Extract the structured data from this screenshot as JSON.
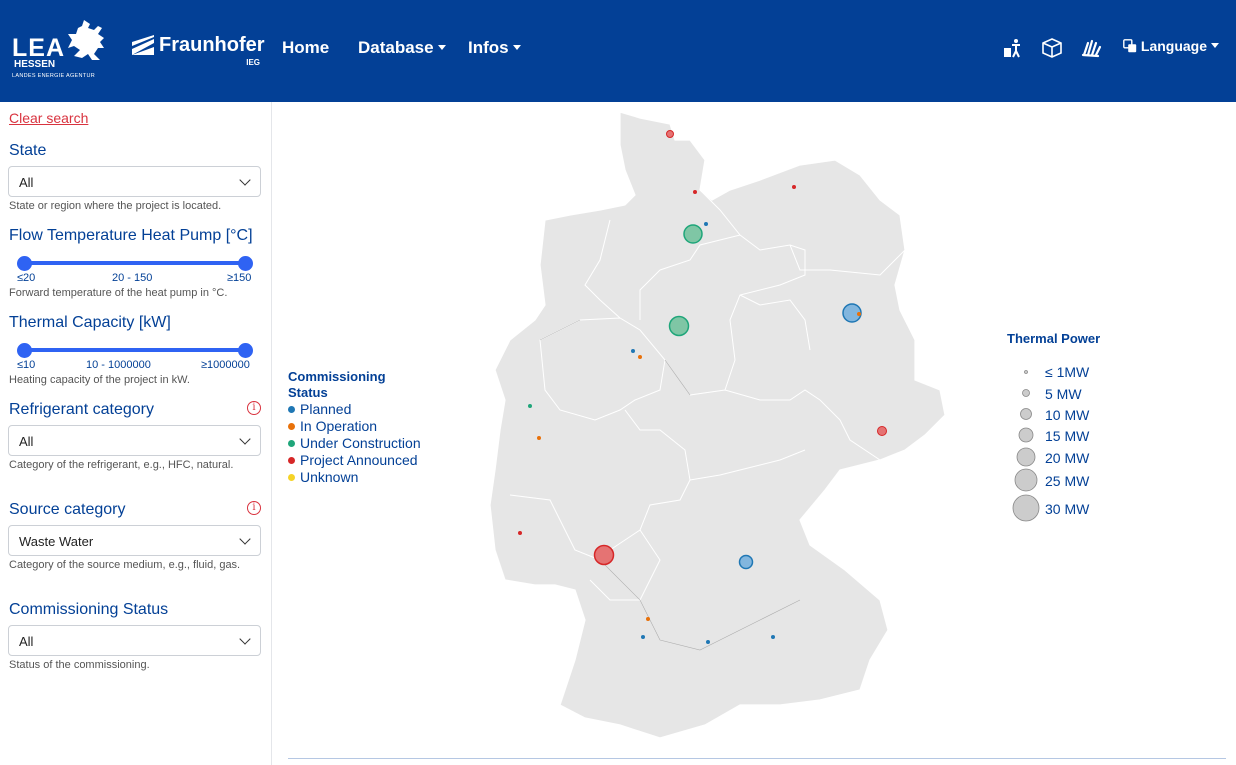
{
  "header": {
    "lea_logo": {
      "main": "LEA",
      "sub1": "HESSEN",
      "sub2": "LANDES ENERGIE AGENTUR"
    },
    "fraunhofer_logo": {
      "name": "Fraunhofer",
      "unit": "IEG"
    },
    "nav": {
      "home": "Home",
      "database": "Database",
      "infos": "Infos"
    },
    "icons": [
      "accessibility-icon",
      "easy-language-icon",
      "sign-language-icon",
      "language-icon"
    ],
    "language_label": "Language"
  },
  "sidebar": {
    "clear_search": "Clear search",
    "state": {
      "label": "State",
      "value": "All",
      "help": "State or region where the project is located."
    },
    "flow_temp": {
      "label": "Flow Temperature Heat Pump [°C]",
      "min_label": "≤20",
      "range_label": "20 - 150",
      "max_label": "≥150",
      "help": "Forward temperature of the heat pump in °C."
    },
    "thermal_capacity": {
      "label": "Thermal Capacity [kW]",
      "min_label": "≤10",
      "range_label": "10 - 1000000",
      "max_label": "≥1000000",
      "help": "Heating capacity of the project in kW."
    },
    "refrigerant": {
      "label": "Refrigerant category",
      "value": "All",
      "help": "Category of the refrigerant, e.g., HFC, natural."
    },
    "source": {
      "label": "Source category",
      "value": "Waste Water",
      "help": "Category of the source medium, e.g., fluid, gas."
    },
    "commissioning": {
      "label": "Commissioning Status",
      "value": "All",
      "help": "Status of the commissioning."
    }
  },
  "legend": {
    "status_title": "Commissioning Status",
    "statuses": [
      {
        "label": "Planned",
        "color": "#1f77b4"
      },
      {
        "label": "In Operation",
        "color": "#e8710a"
      },
      {
        "label": "Under Construction",
        "color": "#1fa67a"
      },
      {
        "label": "Project Announced",
        "color": "#d62728"
      },
      {
        "label": "Unknown",
        "color": "#f5d327"
      }
    ],
    "power_title": "Thermal Power",
    "power_sizes": [
      "≤ 1MW",
      "5 MW",
      "10 MW",
      "15 MW",
      "20 MW",
      "25 MW",
      "30 MW"
    ]
  }
}
